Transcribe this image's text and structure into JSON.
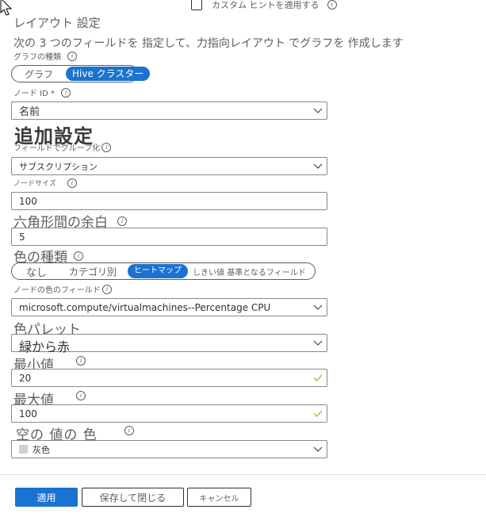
{
  "top": {
    "custom_hint_label": "カスタム ヒントを適用する",
    "custom_hint_checked": false
  },
  "layout": {
    "title": "レイアウト 設定",
    "description": "次の 3 つのフィールドを 指定して、力指向レイアウト でグラフを 作成します",
    "graph_type_label": "グラフの種類",
    "graph_type_options": [
      "グラフ",
      "Hive クラスター"
    ],
    "graph_type_selected": "Hive クラスター",
    "node_id_label": "ノード ID *",
    "node_id_value": "名前"
  },
  "additional": {
    "title": "追加設定",
    "group_by_label": "フィールドでグループ化",
    "group_by_value": "サブスクリプション",
    "node_size_label": "ノードサイズ",
    "node_size_value": "100",
    "hex_margin_label": "六角形間の余白",
    "hex_margin_value": "5",
    "color_type_label": "色の種類",
    "color_type_options": [
      "なし",
      "カテゴリ別",
      "ヒートマップ",
      "しきい値 基準となるフィールド"
    ],
    "color_type_selected": "ヒートマップ",
    "node_color_field_label": "ノードの色のフィールド",
    "node_color_field_value": "microsoft.compute/virtualmachines--Percentage CPU",
    "palette_label": "色パレット",
    "palette_value": "緑から赤",
    "min_label": "最小値",
    "min_value": "20",
    "max_label": "最大値",
    "max_value": "100",
    "empty_color_label": "空の 値の 色",
    "empty_color_value": "灰色",
    "empty_color_swatch": "#d2d0ce"
  },
  "footer": {
    "apply_label": "適用",
    "save_close_label": "保存して閉じる",
    "cancel_label": "キャンセル"
  },
  "icons": {
    "info": "i"
  },
  "colors": {
    "accent": "#1a73d1",
    "valid_check": "#6bb700"
  }
}
